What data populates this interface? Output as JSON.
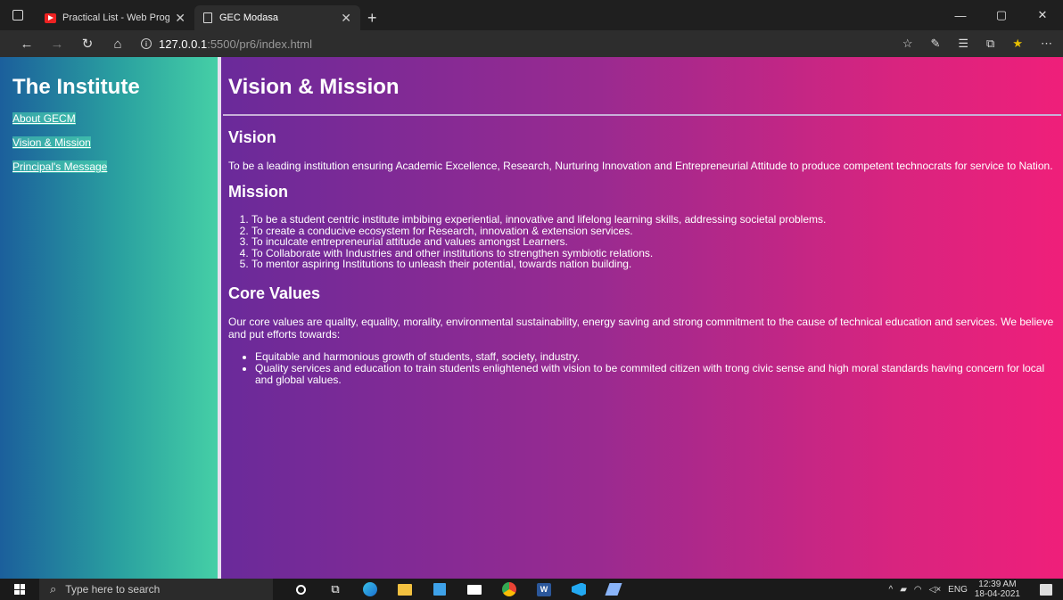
{
  "browser": {
    "tabs": [
      {
        "title": "Practical List - Web Programmin",
        "active": false
      },
      {
        "title": "GEC Modasa",
        "active": true
      }
    ],
    "url_host": "127.0.0.1",
    "url_path": ":5500/pr6/index.html",
    "controls": {
      "minimize": "—",
      "restore": "▢",
      "close": "✕"
    }
  },
  "sidebar": {
    "title": "The Institute",
    "links": [
      "About GECM",
      "Vision & Mission",
      "Principal's Message"
    ]
  },
  "main": {
    "title": "Vision & Mission",
    "vision": {
      "heading": "Vision",
      "text": "To be a leading institution ensuring Academic Excellence, Research, Nurturing Innovation and Entrepreneurial Attitude to produce competent technocrats for service to Nation."
    },
    "mission": {
      "heading": "Mission",
      "items": [
        "To be a student centric institute imbibing experiential, innovative and lifelong learning skills, addressing societal problems.",
        "To create a conducive ecosystem for Research, innovation & extension services.",
        "To inculcate entrepreneurial attitude and values amongst Learners.",
        "To Collaborate with Industries and other institutions to strengthen symbiotic relations.",
        "To mentor aspiring Institutions to unleash their potential, towards nation building."
      ]
    },
    "core_values": {
      "heading": "Core Values",
      "text": "Our core values are quality, equality, morality, environmental sustainability, energy saving and strong commitment to the cause of technical education and services. We believe and put efforts towards:",
      "items": [
        "Equitable and harmonious growth of students, staff, society, industry.",
        "Quality services and education to train students enlightened with vision to be commited citizen with trong civic sense and high moral standards having concern for local and global values."
      ]
    }
  },
  "taskbar": {
    "search_placeholder": "Type here to search",
    "language": "ENG",
    "time": "12:39 AM",
    "date": "18-04-2021"
  }
}
